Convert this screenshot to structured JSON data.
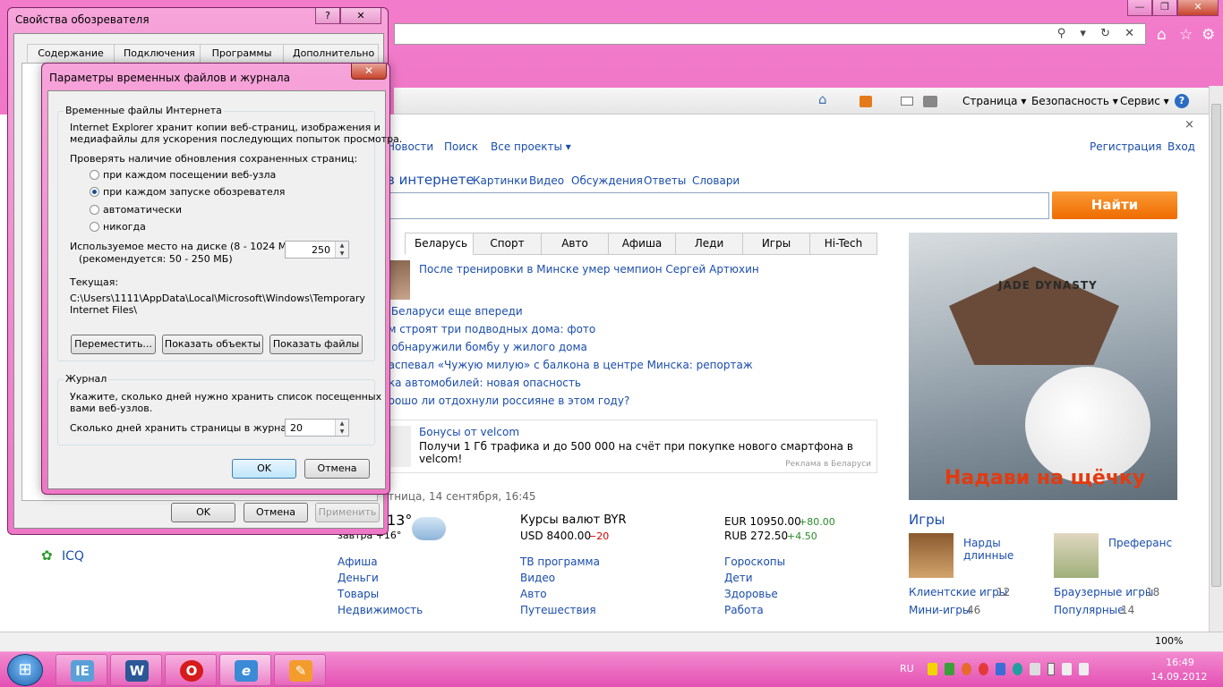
{
  "browser": {
    "addr_icons": "⚲ ▾ ↻ ✕",
    "window_controls": {
      "minimize": "—",
      "restore": "❐",
      "close": "✕"
    },
    "toolbar_icons": {
      "home": "⌂",
      "star": "☆",
      "gear": "⚙"
    },
    "command_bar": {
      "page": "Страница ▾",
      "security": "Безопасность ▾",
      "service": "Сервис ▾",
      "help": "?"
    },
    "zoom": "100%"
  },
  "page": {
    "nav": {
      "news": "Новости",
      "search": "Поиск",
      "all_projects": "Все проекты ▾",
      "register": "Регистрация",
      "login": "Вход",
      "close": "×"
    },
    "search_tabs": {
      "title": "в интернете",
      "items": [
        "Картинки",
        "Видео",
        "Обсуждения",
        "Ответы",
        "Словари"
      ]
    },
    "search_button": "Найти",
    "news_tabs": [
      "Беларусь",
      "Спорт",
      "Авто",
      "Афиша",
      "Леди",
      "Игры",
      "Hi-Tech"
    ],
    "headline": "После тренировки в Минске умер чемпион Сергей Артюхин",
    "news_items": [
      "в Беларуси еще впереди",
      "ом строят три подводных дома: фото",
      "е обнаружили бомбу у жилого дома",
      "распевал «Чужую милую» с балкона в центре Минска: репортаж",
      "пка автомобилей: новая опасность",
      "орошо ли отдохнули россияне в этом году?"
    ],
    "ad": {
      "title": "Бонусы от velcom",
      "text": "Получи 1 Гб трафика и до 500 000 на счёт при покупке нового смартфона в velcom!",
      "footer": "Реклама в Беларуси"
    },
    "date": "ятница, 14 сентября, 16:45",
    "weather": {
      "temp": "13°",
      "tomorrow": "завтра +16°"
    },
    "currency": {
      "title": "Курсы валют BYR",
      "usd": "USD 8400.00",
      "usd_delta": "−20",
      "eur": "EUR 10950.00",
      "eur_delta": "+80.00",
      "rub": "RUB 272.50",
      "rub_delta": "+4.50"
    },
    "links_col1": [
      "Афиша",
      "Деньги",
      "Товары",
      "Недвижимость"
    ],
    "links_col2": [
      "ТВ программа",
      "Видео",
      "Авто",
      "Путешествия"
    ],
    "links_col3": [
      "Гороскопы",
      "Дети",
      "Здоровье",
      "Работа"
    ],
    "left_link": "ICQ",
    "banner": {
      "logo": "JADE DYNASTY",
      "caption": "Надави на щёчку"
    },
    "games": {
      "title": "Игры",
      "game1": "Нарды длинные",
      "game2": "Преферанс",
      "client": "Клиентские игры",
      "client_count": "12",
      "browser": "Браузерные игры",
      "browser_count": "18",
      "mini": "Мини-игры",
      "mini_count": "46",
      "popular": "Популярные",
      "popular_count": "14"
    }
  },
  "props_dialog": {
    "title": "Свойства обозревателя",
    "help_btn": "?",
    "close_btn": "✕",
    "tabs": [
      "Содержание",
      "Подключения",
      "Программы",
      "Дополнительно"
    ],
    "ok": "OK",
    "cancel": "Отмена",
    "apply": "Применить"
  },
  "temp_dialog": {
    "title": "Параметры временных файлов и журнала",
    "close_btn": "✕",
    "group_temp": "Временные файлы Интернета",
    "desc1": "Internet Explorer хранит копии веб-страниц, изображения и",
    "desc2": "медиафайлы для ускорения последующих попыток просмотра.",
    "check_label": "Проверять наличие обновления сохраненных страниц:",
    "radios": [
      "при каждом посещении веб-узла",
      "при каждом запуске обозревателя",
      "автоматически",
      "никогда"
    ],
    "selected_radio": 1,
    "disk_label1": "Используемое место на диске (8 - 1024 МБ):",
    "disk_label2": "(рекомендуется: 50 - 250 МБ)",
    "disk_value": "250",
    "current_label": "Текущая:",
    "path1": "C:\\Users\\1111\\AppData\\Local\\Microsoft\\Windows\\Temporary",
    "path2": "Internet Files\\",
    "btn_move": "Переместить...",
    "btn_objects": "Показать объекты",
    "btn_files": "Показать файлы",
    "group_history": "Журнал",
    "hist1": "Укажите, сколько дней нужно хранить список посещенных",
    "hist2": "вами веб-узлов.",
    "days_label": "Сколько дней хранить страницы в журнале:",
    "days_value": "20",
    "ok": "OK",
    "cancel": "Отмена"
  },
  "taskbar": {
    "start": "⊞",
    "apps": [
      "IE",
      "W",
      "O",
      "e",
      "✎"
    ],
    "lang": "RU",
    "time": "16:49",
    "date": "14.09.2012"
  },
  "colors": {
    "accent_pink": "#ef6bc3",
    "link": "#1a4dab",
    "search_button": "#f57f17"
  }
}
